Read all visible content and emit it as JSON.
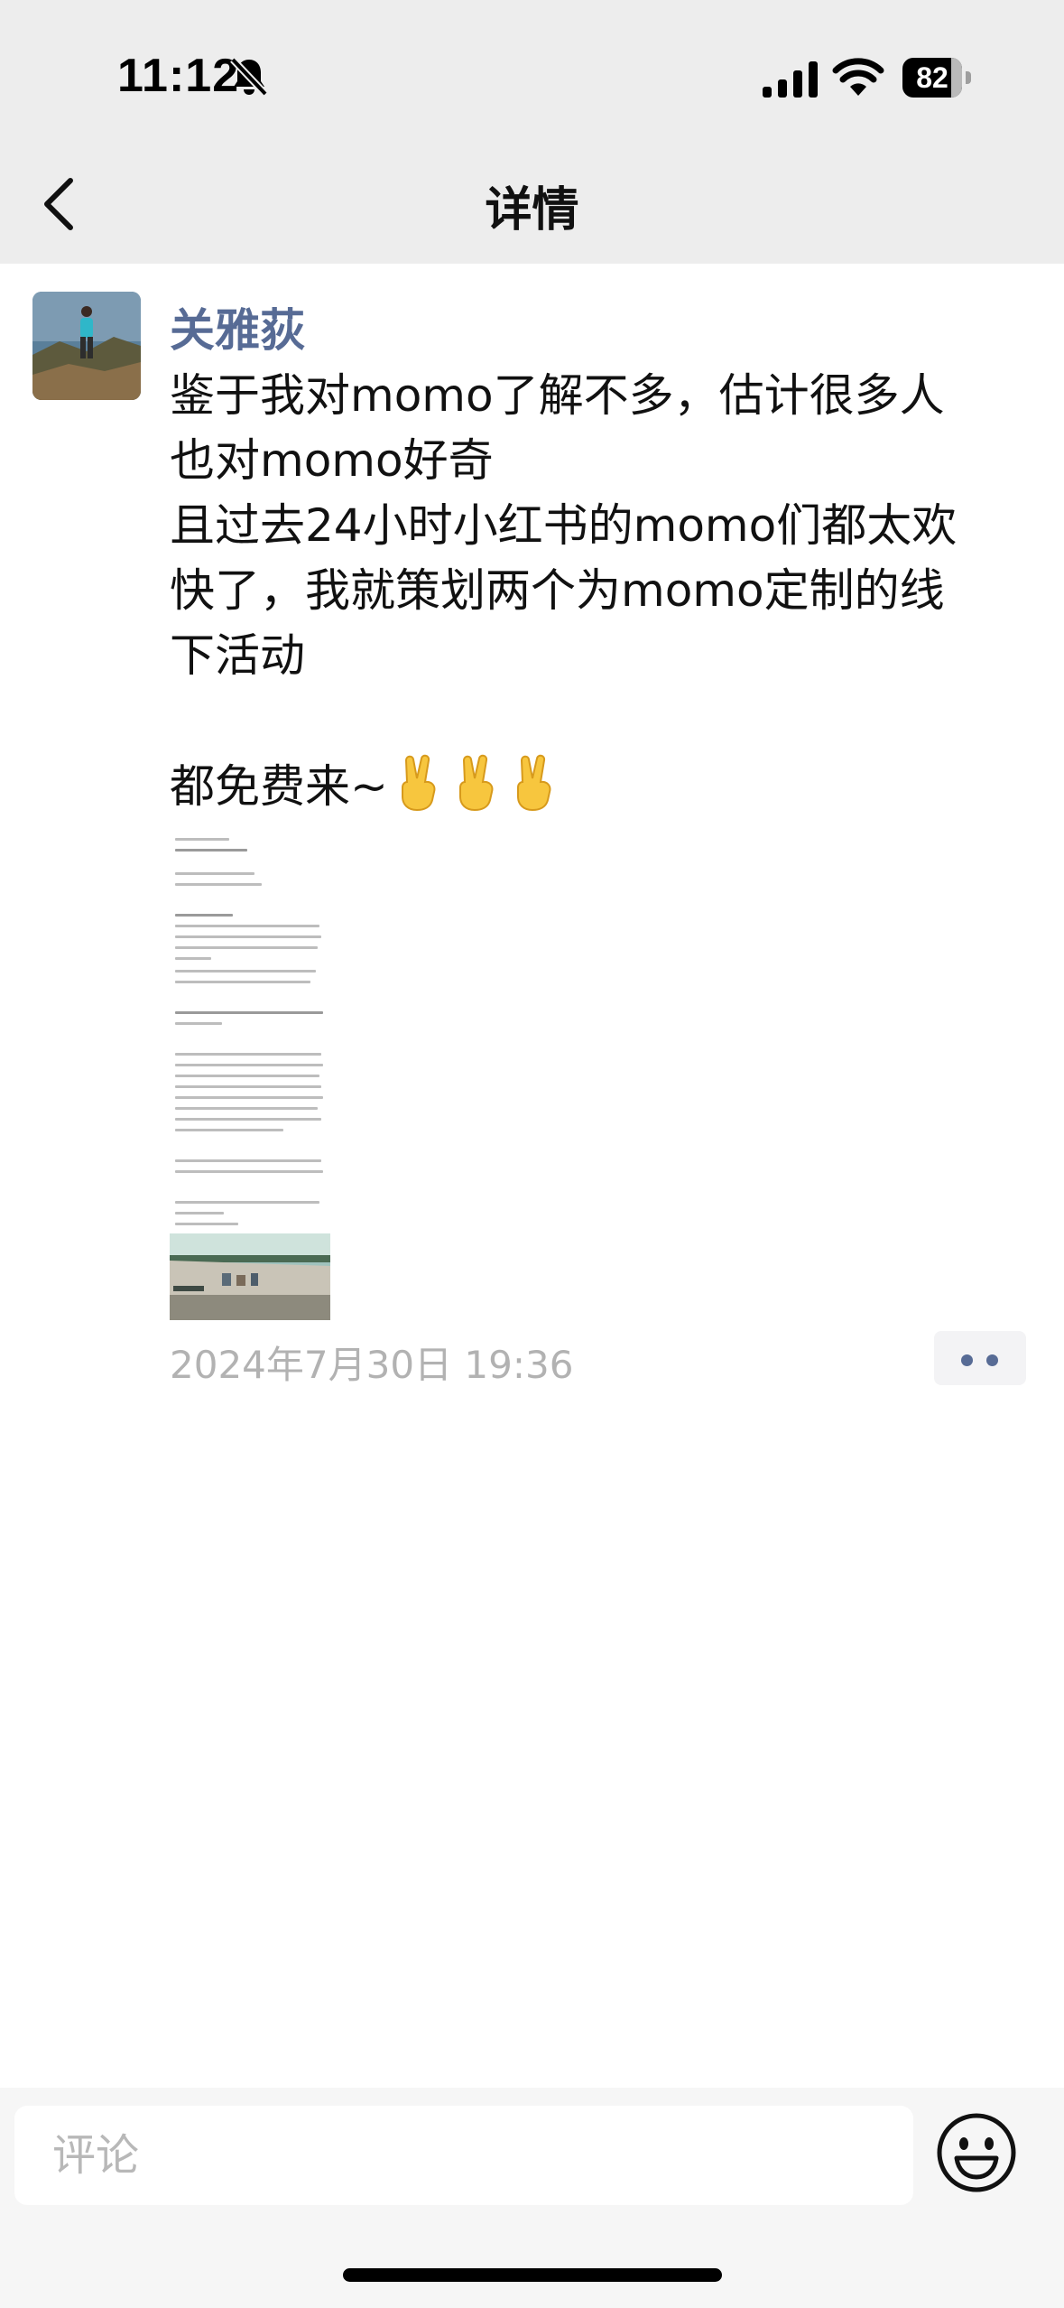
{
  "status_bar": {
    "time": "11:12",
    "battery_level": "82",
    "icons": [
      "bell-slash-icon",
      "cellular-signal-icon",
      "wifi-icon",
      "battery-icon"
    ]
  },
  "nav": {
    "back_icon": "chevron-left-icon",
    "title": "详情"
  },
  "post": {
    "author": "关雅荻",
    "lines": [
      "鉴于我对momo了解不多，估计很多人",
      "也对momo好奇",
      "且过去24小时小红书的momo们都太欢",
      "快了，我就策划两个为momo定制的线",
      "下活动",
      "",
      "都免费来~"
    ],
    "emoji": "victory-hand-icon",
    "emoji_count": 3,
    "timestamp": "2024年7月30日 19:36",
    "more_icon": "ellipsis-icon"
  },
  "comment_bar": {
    "placeholder": "评论",
    "emoji_icon": "smiley-face-icon"
  },
  "colors": {
    "nav_background": "#ededed",
    "author_name": "#576b95",
    "timestamp": "#b2b2b2",
    "comment_bar_background": "#f6f6f6"
  }
}
